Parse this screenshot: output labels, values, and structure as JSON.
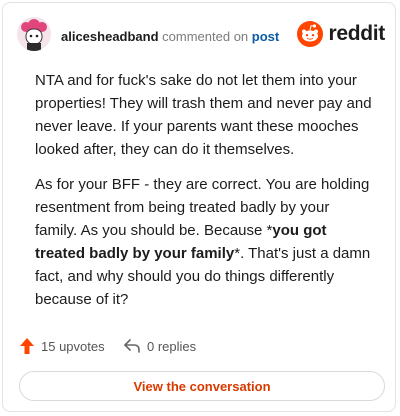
{
  "header": {
    "username": "alicesheadband",
    "commented_text": "commented on",
    "post_link": "post",
    "brand_word": "reddit"
  },
  "comment": {
    "paragraph1": "NTA and for fuck's sake do not let them into your properties! They will trash them and never pay and never leave. If your parents want these mooches looked after, they can do it themselves.",
    "paragraph2_before": "As for your BFF - they are correct. You are holding resentment from being treated badly by your family. As you should be. Because *",
    "paragraph2_bold": "you got treated badly by your family",
    "paragraph2_after": "*. That's just a damn fact, and why should you do things differently because of it?"
  },
  "actions": {
    "upvotes": "15 upvotes",
    "replies": "0 replies"
  },
  "cta_label": "View the conversation",
  "colors": {
    "accent": "#ff4500",
    "upvote": "#ff4500",
    "link": "#0b5ba8",
    "cta_text": "#d93a00"
  },
  "icons": {
    "avatar": "avatar-icon",
    "brand": "reddit-logo-icon",
    "upvote": "upvote-arrow-icon",
    "reply": "reply-arrow-icon"
  }
}
